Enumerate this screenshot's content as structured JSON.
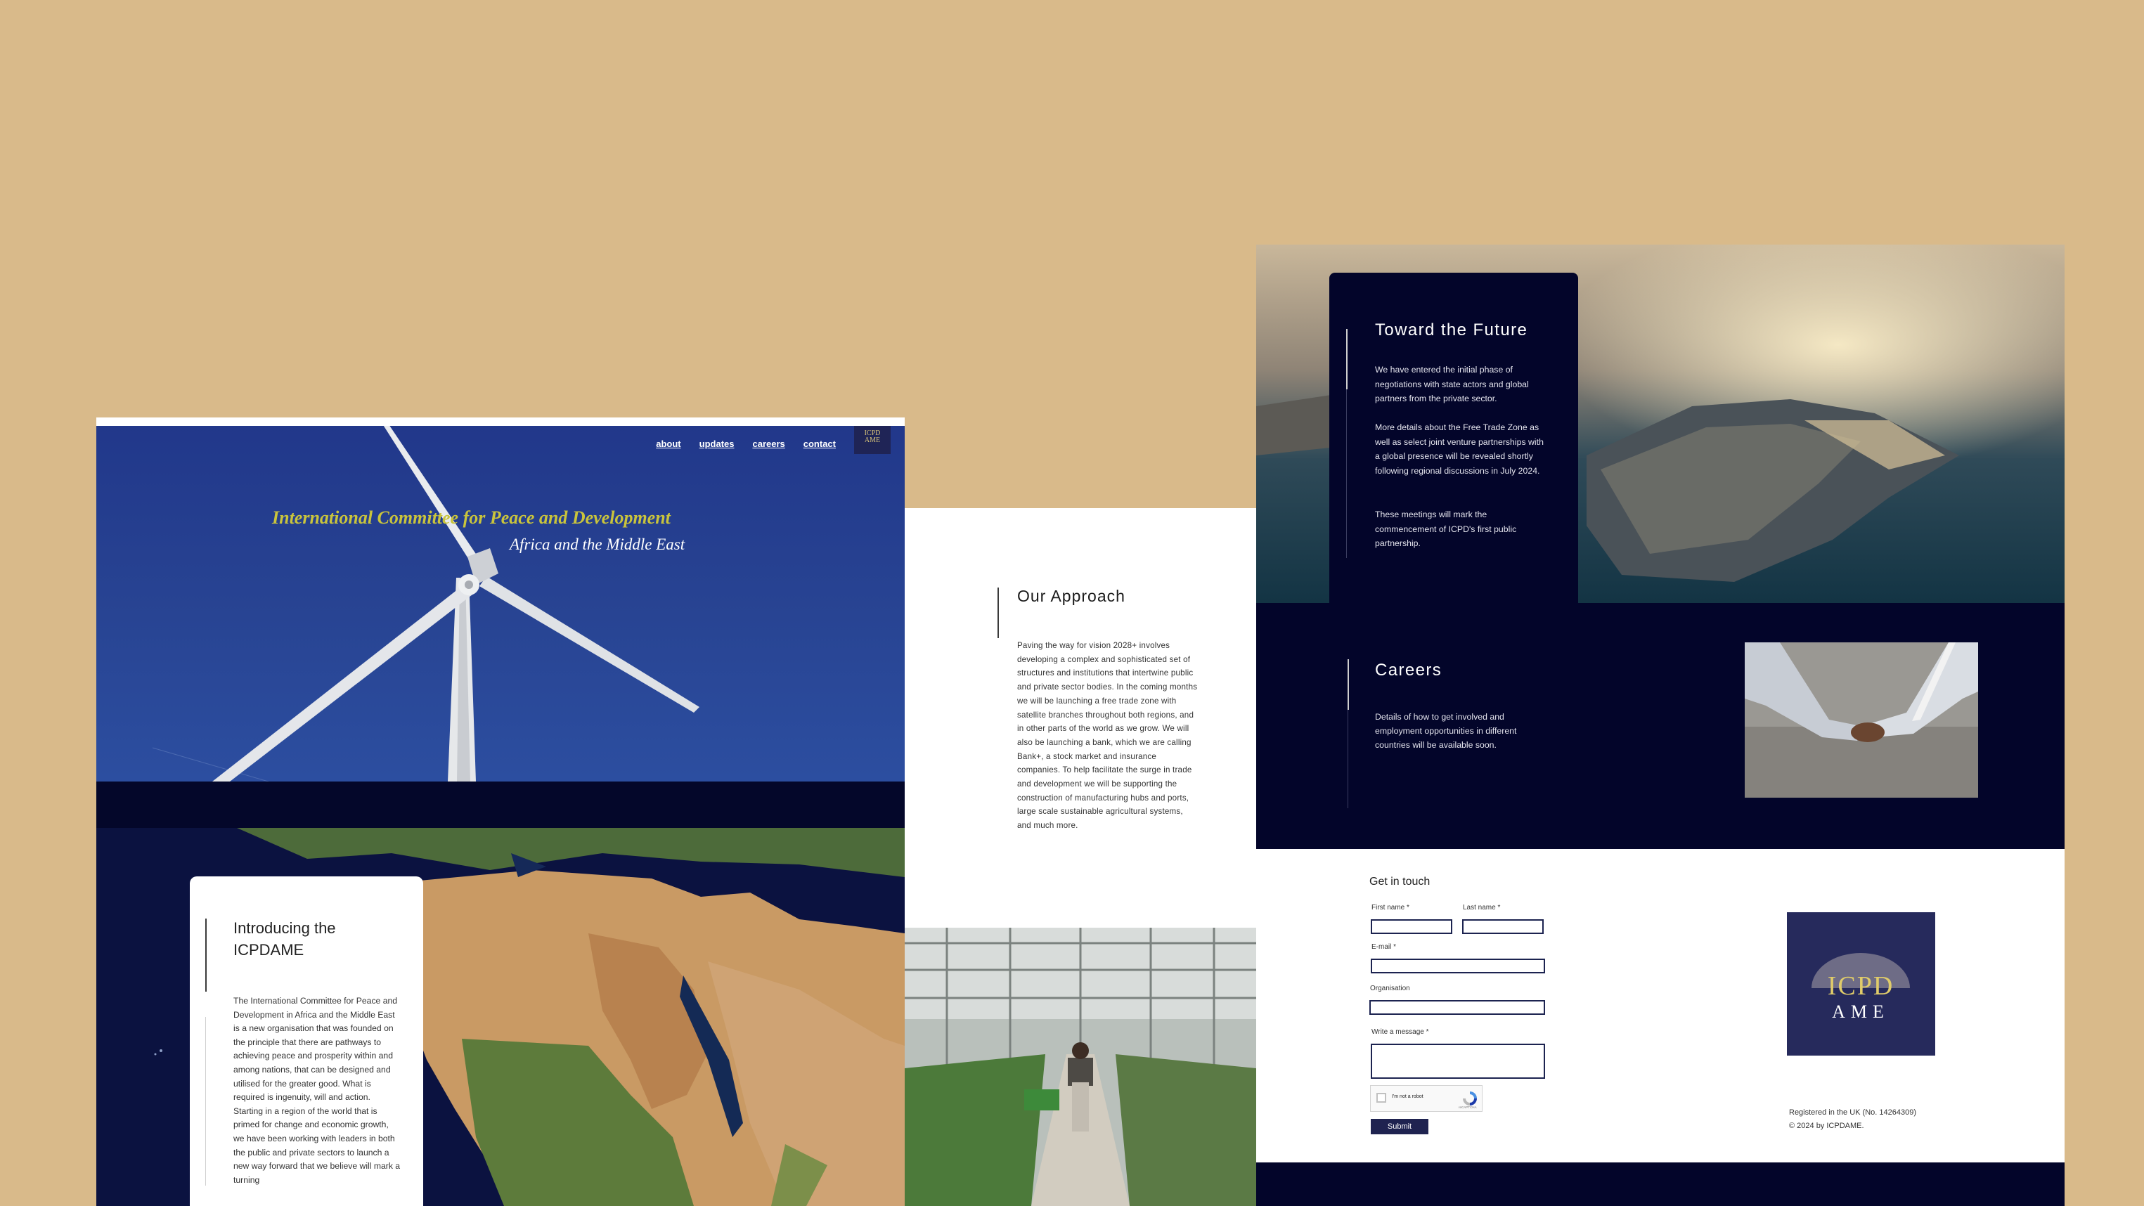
{
  "nav": {
    "links": [
      "about",
      "updates",
      "careers",
      "contact"
    ],
    "logo_line1": "ICPD",
    "logo_line2": "AME"
  },
  "hero": {
    "title": "International Committee for Peace and Development",
    "subtitle": "Africa and the Middle East"
  },
  "intro": {
    "title": "Introducing the ICPDAME",
    "body": "The International Committee for Peace and Development in Africa and the Middle East is a new organisation that was founded on the principle that there are pathways to achieving peace and prosperity within and among nations, that can be designed and utilised for the greater good. What is required is ingenuity, will and action. Starting in a region of the world that is primed for change and economic growth, we have been working with leaders in both the public and private sectors to launch a new way forward that we believe will mark a turning"
  },
  "approach": {
    "title": "Our Approach",
    "body": "Paving the way for vision 2028+ involves developing a complex and sophisticated set of structures and institutions that intertwine public and private sector bodies. In the coming months we will be launching a free trade zone with satellite branches throughout both regions, and in other parts of the world as we grow. We will also be launching a bank, which we are calling Bank+, a stock market and insurance companies. To help facilitate the surge in trade and development we will be supporting the construction of manufacturing hubs and ports, large scale sustainable agricultural systems, and much more."
  },
  "future": {
    "title": "Toward the Future",
    "p1": "We have entered the initial phase of negotiations with state actors and global partners from the private sector.",
    "p2": "More details about the Free Trade Zone as well as select joint venture partnerships with a global presence will be revealed shortly following regional discussions in July 2024.",
    "p3": "These meetings will mark the commencement of ICPD's first public partnership."
  },
  "careers": {
    "title": "Careers",
    "body": "Details of how to get involved and employment opportunities in different countries will be available soon."
  },
  "contact": {
    "title": "Get in touch",
    "first_name_label": "First name *",
    "last_name_label": "Last name *",
    "email_label": "E-mail *",
    "org_label": "Organisation",
    "message_label": "Write a message *",
    "captcha_text": "I'm not a robot",
    "captcha_brand": "reCAPTCHA",
    "submit_label": "Submit"
  },
  "footer": {
    "logo_line1": "ICPD",
    "logo_line2": "AME",
    "registered": "Registered in the UK (No. 14264309)",
    "copyright": "© 2024 by ICPDAME."
  },
  "colors": {
    "background": "#d9ba8a",
    "navy": "#03052a",
    "hero_blue": "#253e8a",
    "gold": "#c9c43c",
    "logo_bg": "#262a5c"
  }
}
